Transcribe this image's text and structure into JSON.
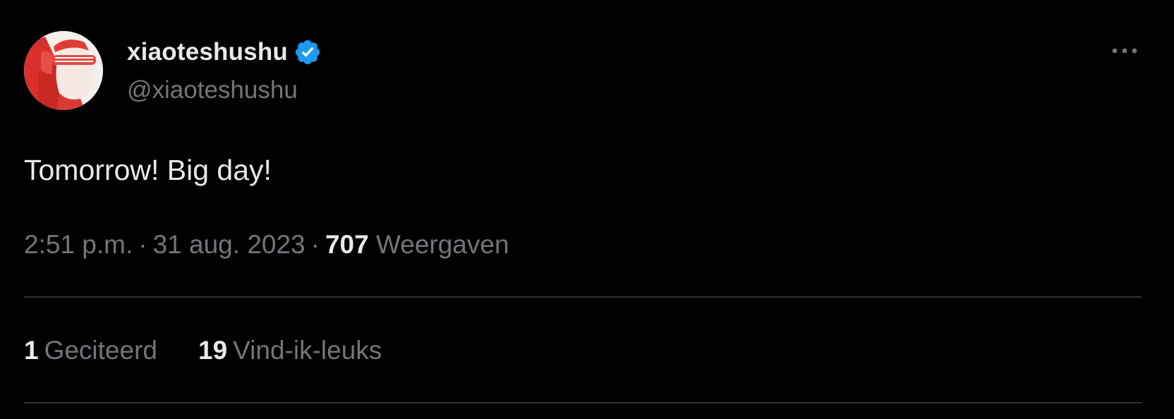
{
  "author": {
    "display_name": "xiaoteshushu",
    "handle": "@xiaoteshushu",
    "verified_icon": "verified-badge-icon",
    "avatar_icon": "avatar-red-sunglasses"
  },
  "menu": {
    "icon": "more-horizontal-icon"
  },
  "tweet": {
    "text": "Tomorrow! Big day!",
    "time": "2:51 p.m.",
    "separator": "·",
    "date": "31 aug. 2023",
    "views_count": "707",
    "views_label": "Weergaven"
  },
  "stats": [
    {
      "count": "1",
      "label": "Geciteerd"
    },
    {
      "count": "19",
      "label": "Vind-ik-leuks"
    }
  ],
  "colors": {
    "background": "#000000",
    "primary_text": "#e7e9ea",
    "secondary_text": "#71767b",
    "divider": "#2f3336",
    "verified_blue": "#1d9bf0"
  }
}
